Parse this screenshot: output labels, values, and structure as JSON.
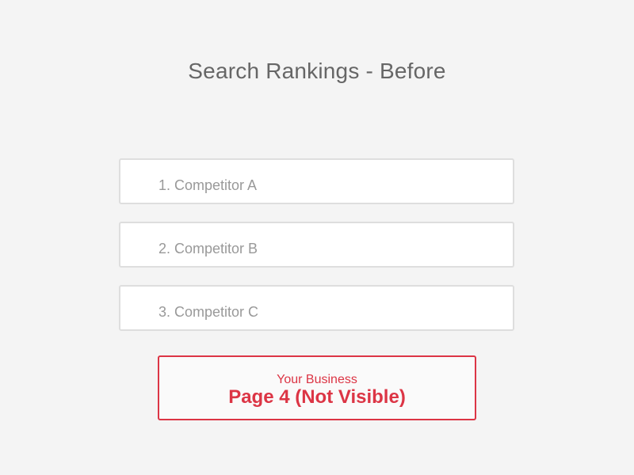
{
  "header": {
    "title": "Search Rankings - Before"
  },
  "rankings": [
    {
      "label": "1. Competitor A"
    },
    {
      "label": "2. Competitor B"
    },
    {
      "label": "3. Competitor C"
    }
  ],
  "business": {
    "name": "Your Business",
    "status": "Page 4 (Not Visible)"
  },
  "colors": {
    "background": "#f4f4f4",
    "title_text": "#666666",
    "rank_text": "#999999",
    "alert": "#dc3545"
  }
}
